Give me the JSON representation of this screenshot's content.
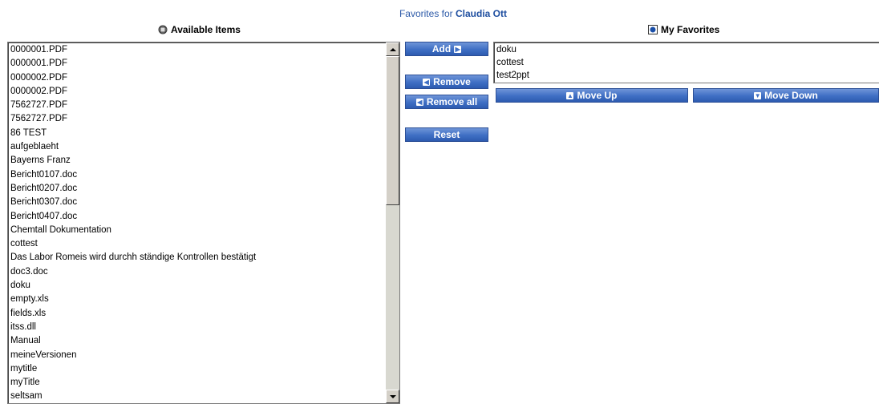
{
  "header": {
    "favorites_prefix": "Favorites for",
    "user_name": "Claudia Ott"
  },
  "available": {
    "title": "Available Items",
    "items": [
      "0000001.PDF",
      "0000001.PDF",
      "0000002.PDF",
      "0000002.PDF",
      "7562727.PDF",
      "7562727.PDF",
      "86 TEST",
      "aufgeblaeht",
      "Bayerns Franz",
      "Bericht0107.doc",
      "Bericht0207.doc",
      "Bericht0307.doc",
      "Bericht0407.doc",
      "Chemtall Dokumentation",
      "cottest",
      "Das Labor Romeis wird durchh ständige Kontrollen bestätigt",
      "doc3.doc",
      "doku",
      "empty.xls",
      "fields.xls",
      "itss.dll",
      "Manual",
      "meineVersionen",
      "mytitle",
      "myTitle",
      "seltsam"
    ]
  },
  "favorites": {
    "title": "My Favorites",
    "items": [
      "doku",
      "cottest",
      "test2ppt"
    ]
  },
  "buttons": {
    "add": "Add",
    "remove": "Remove",
    "remove_all": "Remove all",
    "reset": "Reset",
    "move_up": "Move Up",
    "move_down": "Move Down"
  },
  "colors": {
    "button_blue": "#3f6fc4",
    "title_blue": "#2d5aa8"
  }
}
